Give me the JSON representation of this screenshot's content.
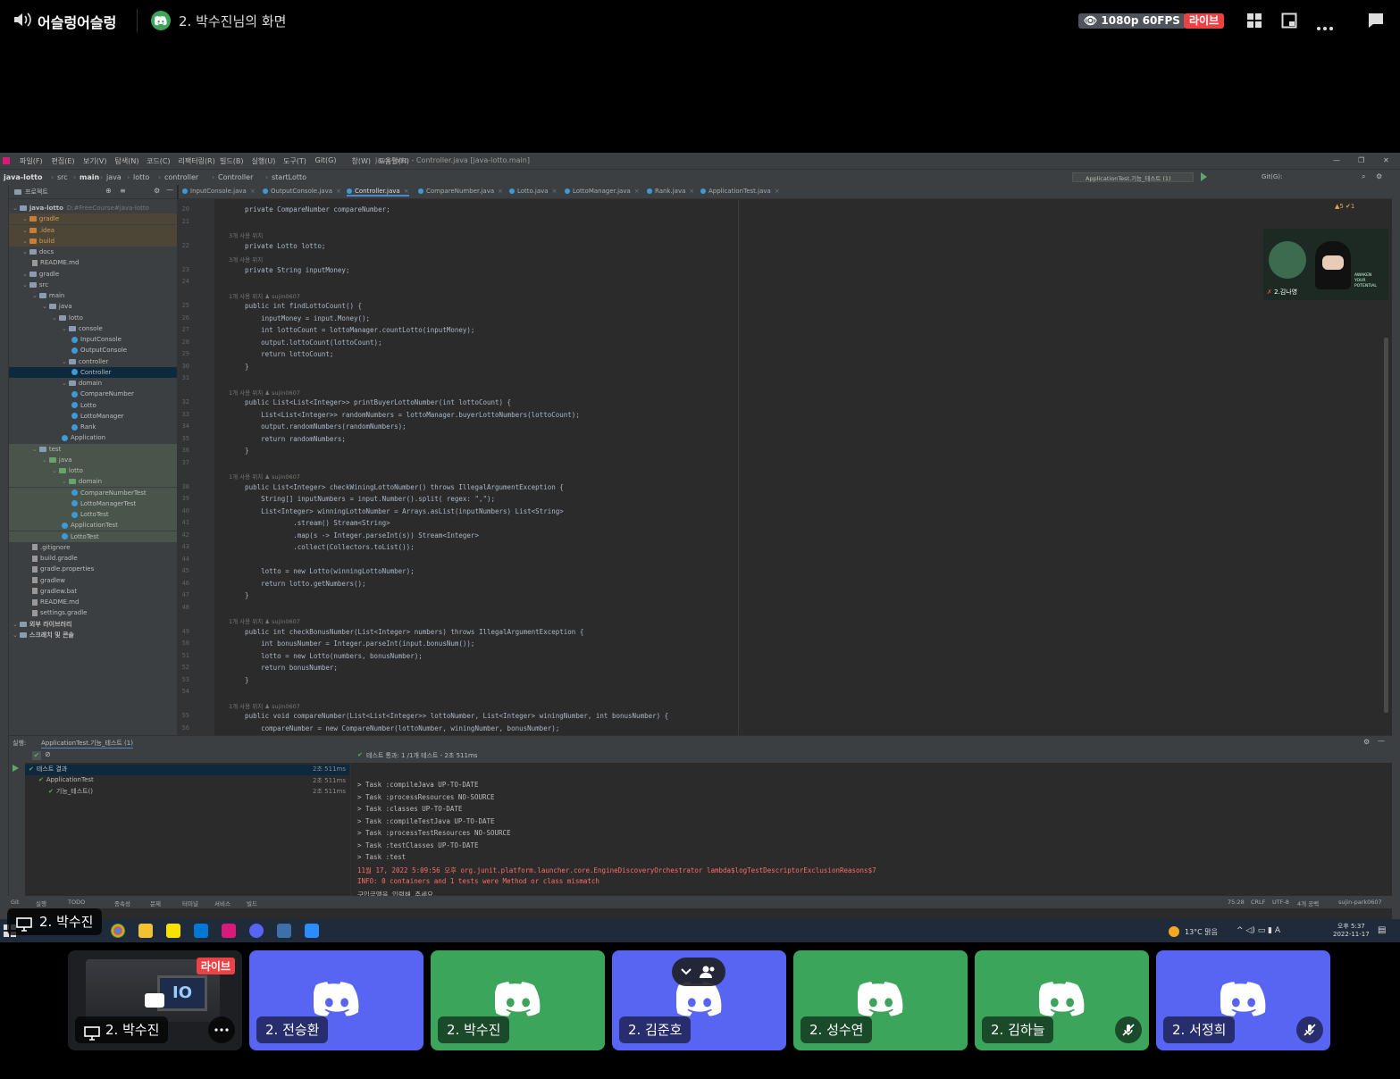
{
  "topbar": {
    "server_name": "어슬렁어슬렁",
    "stream_title": "2. 박수진님의 화면",
    "quality": "1080p 60FPS",
    "live": "라이브",
    "icons": [
      "speaker-icon",
      "discord-logo-icon",
      "grid-icon",
      "popout-icon",
      "more-icon",
      "chat-icon"
    ]
  },
  "ide": {
    "menu": [
      "파일(F)",
      "편집(E)",
      "보기(V)",
      "탐색(N)",
      "코드(C)",
      "리팩터링(R)",
      "빌드(B)",
      "실행(U)",
      "도구(T)",
      "Git(G)",
      "창(W)",
      "도움말(H)"
    ],
    "window_title": "java-lotto - Controller.java [java-lotto.main]",
    "breadcrumbs": [
      "java-lotto",
      "src",
      "main",
      "java",
      "lotto",
      "controller",
      "Controller",
      "startLotto"
    ],
    "run_config": "ApplicationTest.기능_테스트 (1)",
    "git_label": "Git(G):",
    "project_header": "프로젝트",
    "tabs": [
      "InputConsole.java",
      "OutputConsole.java",
      "Controller.java",
      "CompareNumber.java",
      "Lotto.java",
      "LottoManager.java",
      "Rank.java",
      "ApplicationTest.java"
    ],
    "active_tab": 2,
    "warnings": "▲5 ✔1",
    "tree": [
      {
        "label": "java-lotto",
        "suffix": "D:#FreeCourse#java-lotto",
        "depth": 0,
        "kind": "folder"
      },
      {
        "label": "gradle",
        "depth": 1,
        "kind": "folder-excluded"
      },
      {
        "label": ".idea",
        "depth": 1,
        "kind": "folder-excluded"
      },
      {
        "label": "build",
        "depth": 1,
        "kind": "folder-excluded"
      },
      {
        "label": "docs",
        "depth": 1,
        "kind": "folder"
      },
      {
        "label": "README.md",
        "depth": 2,
        "kind": "file"
      },
      {
        "label": "gradle",
        "depth": 1,
        "kind": "folder"
      },
      {
        "label": "src",
        "depth": 1,
        "kind": "folder"
      },
      {
        "label": "main",
        "depth": 2,
        "kind": "folder"
      },
      {
        "label": "java",
        "depth": 3,
        "kind": "folder"
      },
      {
        "label": "lotto",
        "depth": 4,
        "kind": "folder"
      },
      {
        "label": "console",
        "depth": 5,
        "kind": "folder"
      },
      {
        "label": "InputConsole",
        "depth": 6,
        "kind": "class"
      },
      {
        "label": "OutputConsole",
        "depth": 6,
        "kind": "class"
      },
      {
        "label": "controller",
        "depth": 5,
        "kind": "folder"
      },
      {
        "label": "Controller",
        "depth": 6,
        "kind": "class",
        "selected": true
      },
      {
        "label": "domain",
        "depth": 5,
        "kind": "folder"
      },
      {
        "label": "CompareNumber",
        "depth": 6,
        "kind": "class"
      },
      {
        "label": "Lotto",
        "depth": 6,
        "kind": "class"
      },
      {
        "label": "LottoManager",
        "depth": 6,
        "kind": "class"
      },
      {
        "label": "Rank",
        "depth": 6,
        "kind": "class"
      },
      {
        "label": "Application",
        "depth": 5,
        "kind": "class"
      },
      {
        "label": "test",
        "depth": 2,
        "kind": "folder"
      },
      {
        "label": "java",
        "depth": 3,
        "kind": "folder-test"
      },
      {
        "label": "lotto",
        "depth": 4,
        "kind": "folder-test"
      },
      {
        "label": "domain",
        "depth": 5,
        "kind": "folder-test"
      },
      {
        "label": "CompareNumberTest",
        "depth": 6,
        "kind": "class-test"
      },
      {
        "label": "LottoManagerTest",
        "depth": 6,
        "kind": "class-test"
      },
      {
        "label": "LottoTest",
        "depth": 6,
        "kind": "class-test"
      },
      {
        "label": "ApplicationTest",
        "depth": 5,
        "kind": "class-test"
      },
      {
        "label": "LottoTest",
        "depth": 5,
        "kind": "class-test"
      },
      {
        "label": ".gitignore",
        "depth": 2,
        "kind": "file"
      },
      {
        "label": "build.gradle",
        "depth": 2,
        "kind": "file"
      },
      {
        "label": "gradle.properties",
        "depth": 2,
        "kind": "file"
      },
      {
        "label": "gradlew",
        "depth": 2,
        "kind": "file"
      },
      {
        "label": "gradlew.bat",
        "depth": 2,
        "kind": "file"
      },
      {
        "label": "README.md",
        "depth": 2,
        "kind": "file"
      },
      {
        "label": "settings.gradle",
        "depth": 2,
        "kind": "file"
      },
      {
        "label": "외부 라이브러리",
        "depth": 0,
        "kind": "folder"
      },
      {
        "label": "스크래치 및 콘솔",
        "depth": 0,
        "kind": "folder"
      }
    ],
    "code_lines": [
      {
        "n": "20",
        "t": "    private CompareNumber compareNumber;"
      },
      {
        "n": "21",
        "t": ""
      },
      {
        "n": "",
        "t": "3개 사용 위치",
        "hint": true
      },
      {
        "n": "22",
        "t": "    private Lotto lotto;"
      },
      {
        "n": "",
        "t": "3개 사용 위치",
        "hint": true
      },
      {
        "n": "23",
        "t": "    private String inputMoney;"
      },
      {
        "n": "24",
        "t": ""
      },
      {
        "n": "",
        "t": "1개 사용 위치   ♟ sujin0607",
        "hint": true
      },
      {
        "n": "25",
        "t": "    public int findLottoCount() {"
      },
      {
        "n": "26",
        "t": "        inputMoney = input.Money();"
      },
      {
        "n": "27",
        "t": "        int lottoCount = lottoManager.countLotto(inputMoney);"
      },
      {
        "n": "28",
        "t": "        output.lottoCount(lottoCount);"
      },
      {
        "n": "29",
        "t": "        return lottoCount;"
      },
      {
        "n": "30",
        "t": "    }"
      },
      {
        "n": "31",
        "t": ""
      },
      {
        "n": "",
        "t": "1개 사용 위치   ♟ sujin0607",
        "hint": true
      },
      {
        "n": "32",
        "t": "    public List<List<Integer>> printBuyerLottoNumber(int lottoCount) {"
      },
      {
        "n": "33",
        "t": "        List<List<Integer>> randomNumbers = lottoManager.buyerLottoNumbers(lottoCount);"
      },
      {
        "n": "34",
        "t": "        output.randomNumbers(randomNumbers);"
      },
      {
        "n": "35",
        "t": "        return randomNumbers;"
      },
      {
        "n": "36",
        "t": "    }"
      },
      {
        "n": "37",
        "t": ""
      },
      {
        "n": "",
        "t": "1개 사용 위치   ♟ sujin0607",
        "hint": true
      },
      {
        "n": "38",
        "t": "    public List<Integer> checkWiningLottoNumber() throws IllegalArgumentException {"
      },
      {
        "n": "39",
        "t": "        String[] inputNumbers = input.Number().split( regex: \",\");"
      },
      {
        "n": "40",
        "t": "        List<Integer> winningLottoNumber = Arrays.asList(inputNumbers) List<String>"
      },
      {
        "n": "41",
        "t": "                .stream() Stream<String>"
      },
      {
        "n": "42",
        "t": "                .map(s -> Integer.parseInt(s)) Stream<Integer>"
      },
      {
        "n": "43",
        "t": "                .collect(Collectors.toList());"
      },
      {
        "n": "44",
        "t": ""
      },
      {
        "n": "45",
        "t": "        lotto = new Lotto(winningLottoNumber);"
      },
      {
        "n": "46",
        "t": "        return lotto.getNumbers();"
      },
      {
        "n": "47",
        "t": "    }"
      },
      {
        "n": "48",
        "t": ""
      },
      {
        "n": "",
        "t": "1개 사용 위치   ♟ sujin0607",
        "hint": true
      },
      {
        "n": "49",
        "t": "    public int checkBonusNumber(List<Integer> numbers) throws IllegalArgumentException {"
      },
      {
        "n": "50",
        "t": "        int bonusNumber = Integer.parseInt(input.bonusNum());"
      },
      {
        "n": "51",
        "t": "        lotto = new Lotto(numbers, bonusNumber);"
      },
      {
        "n": "52",
        "t": "        return bonusNumber;"
      },
      {
        "n": "53",
        "t": "    }"
      },
      {
        "n": "54",
        "t": ""
      },
      {
        "n": "",
        "t": "1개 사용 위치   ♟ sujin0607",
        "hint": true
      },
      {
        "n": "55",
        "t": "    public void compareNumber(List<List<Integer>> lottoNumber, List<Integer> winingNumber, int bonusNumber) {"
      },
      {
        "n": "56",
        "t": "        compareNumber = new CompareNumber(lottoNumber, winingNumber, bonusNumber);"
      }
    ],
    "webcam_label": "2.김나영",
    "webcam_poster": [
      "AWAKEN",
      "YOUR",
      "POTENTIAL"
    ],
    "run": {
      "label": "실행:",
      "tab": "ApplicationTest.기능_테스트 (1)",
      "result": "테스트 통과: 1 /1개 테스트 - 2초 511ms",
      "tree": [
        {
          "label": "테스트 결과",
          "time": "2초 511ms"
        },
        {
          "label": "ApplicationTest",
          "time": "2초 511ms"
        },
        {
          "label": "기능_테스트()",
          "time": "2초 511ms"
        }
      ],
      "console": [
        {
          "t": "> Task :compileJava UP-TO-DATE"
        },
        {
          "t": "> Task :processResources NO-SOURCE"
        },
        {
          "t": "> Task :classes UP-TO-DATE"
        },
        {
          "t": "> Task :compileTestJava UP-TO-DATE"
        },
        {
          "t": "> Task :processTestResources NO-SOURCE"
        },
        {
          "t": "> Task :testClasses UP-TO-DATE"
        },
        {
          "t": "> Task :test"
        },
        {
          "t": "11월 17, 2022 5:09:56 오후 org.junit.platform.launcher.core.EngineDiscoveryOrchestrator lambda$logTestDescriptorExclusionReasons$7",
          "err": true
        },
        {
          "t": "INFO: 0 containers and 1 tests were Method or class mismatch",
          "err": true
        },
        {
          "t": "구입금액을 입력해 주세요."
        }
      ]
    },
    "bottom_tools": [
      "Git",
      "실행",
      "TODO",
      "종속성",
      "문제",
      "터미널",
      "서비스",
      "빌드"
    ],
    "status": [
      "75:28",
      "CRLF",
      "UTF-8",
      "4개 공백",
      "sujin-park0607"
    ],
    "taskbar": {
      "weather": "13°C 맑음",
      "time": "오후 5:37",
      "date": "2022-11-17"
    }
  },
  "presenter_label": "2. 박수진",
  "tiles": [
    {
      "name": "2. 박수진",
      "kind": "stream",
      "badge": "라이브",
      "color": "#1e1f22"
    },
    {
      "name": "2. 전승환",
      "kind": "user",
      "color": "#5865f2"
    },
    {
      "name": "2. 박수진",
      "kind": "user",
      "color": "#3ba55c"
    },
    {
      "name": "2. 김준호",
      "kind": "user",
      "color": "#5865f2"
    },
    {
      "name": "2. 성수연",
      "kind": "user",
      "color": "#3ba55c"
    },
    {
      "name": "2. 김하늘",
      "kind": "user",
      "color": "#3ba55c",
      "muted": true
    },
    {
      "name": "2. 서정희",
      "kind": "user",
      "color": "#5865f2",
      "muted": true
    }
  ]
}
